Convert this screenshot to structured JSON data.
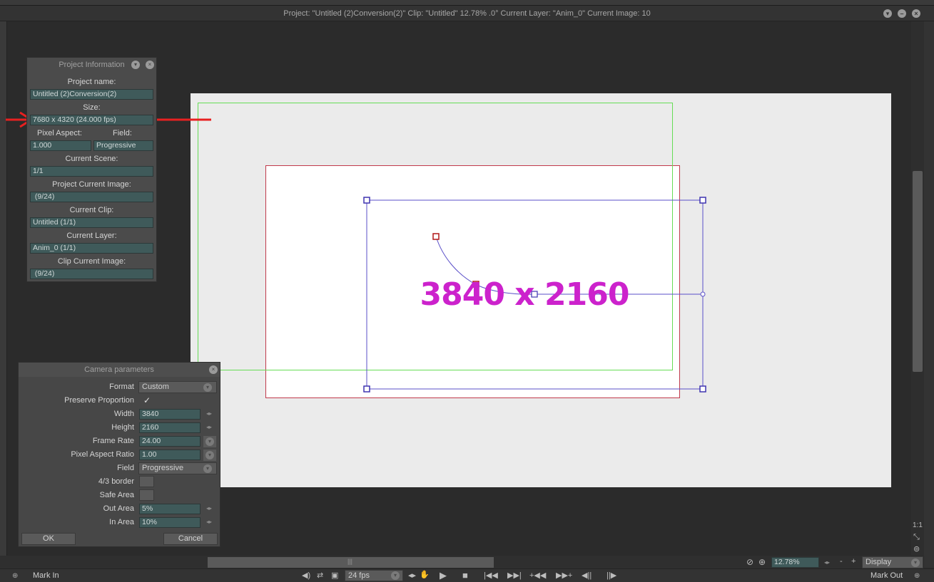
{
  "window": {
    "title": "Project:  \"Untitled (2)Conversion(2)\"  Clip: \"Untitled\"   12.78%  .0°  Current Layer: \"Anim_0\"  Current Image: 10"
  },
  "canvas": {
    "label": "3840 x 2160",
    "colors": {
      "background": "#ebebeb",
      "frame_border": "#c0394b",
      "safe_area": "#66dd55",
      "camera": "#5a4fc8",
      "label": "#cc22cc",
      "annotation_arrow": "#e82020"
    }
  },
  "project_panel": {
    "title": "Project Information",
    "project_name_label": "Project name:",
    "project_name": "Untitled (2)Conversion(2)",
    "size_label": "Size:",
    "size": "7680 x 4320 (24.000 fps)",
    "pixel_aspect_label": "Pixel Aspect:",
    "pixel_aspect": "1.000",
    "field_label": "Field:",
    "field": "Progressive",
    "current_scene_label": "Current Scene:",
    "current_scene": "1/1",
    "project_current_image_label": "Project Current Image:",
    "project_current_image": " (9/24)",
    "current_clip_label": "Current Clip:",
    "current_clip": "Untitled (1/1)",
    "current_layer_label": "Current Layer:",
    "current_layer": "Anim_0 (1/1)",
    "clip_current_image_label": "Clip Current Image:",
    "clip_current_image": " (9/24)"
  },
  "camera_panel": {
    "title": "Camera parameters",
    "format_label": "Format",
    "format": "Custom",
    "preserve_label": "Preserve Proportion",
    "preserve_check": "✓",
    "width_label": "Width",
    "width": "3840",
    "height_label": "Height",
    "height": "2160",
    "frame_rate_label": "Frame Rate",
    "frame_rate": "24.00",
    "par_label": "Pixel Aspect Ratio",
    "par": "1.00",
    "field_label": "Field",
    "field": "Progressive",
    "border43_label": "4/3 border",
    "safe_area_label": "Safe Area",
    "out_area_label": "Out Area",
    "out_area": "5%",
    "in_area_label": "In Area",
    "in_area": "10%",
    "ok": "OK",
    "cancel": "Cancel"
  },
  "bottom": {
    "mark_in": "Mark In",
    "mark_out": "Mark Out",
    "fps": "24 fps",
    "zoom": "12.78%",
    "display": "Display",
    "zoom_minus": "-",
    "zoom_plus": "+",
    "ratio_button": "1:1"
  }
}
